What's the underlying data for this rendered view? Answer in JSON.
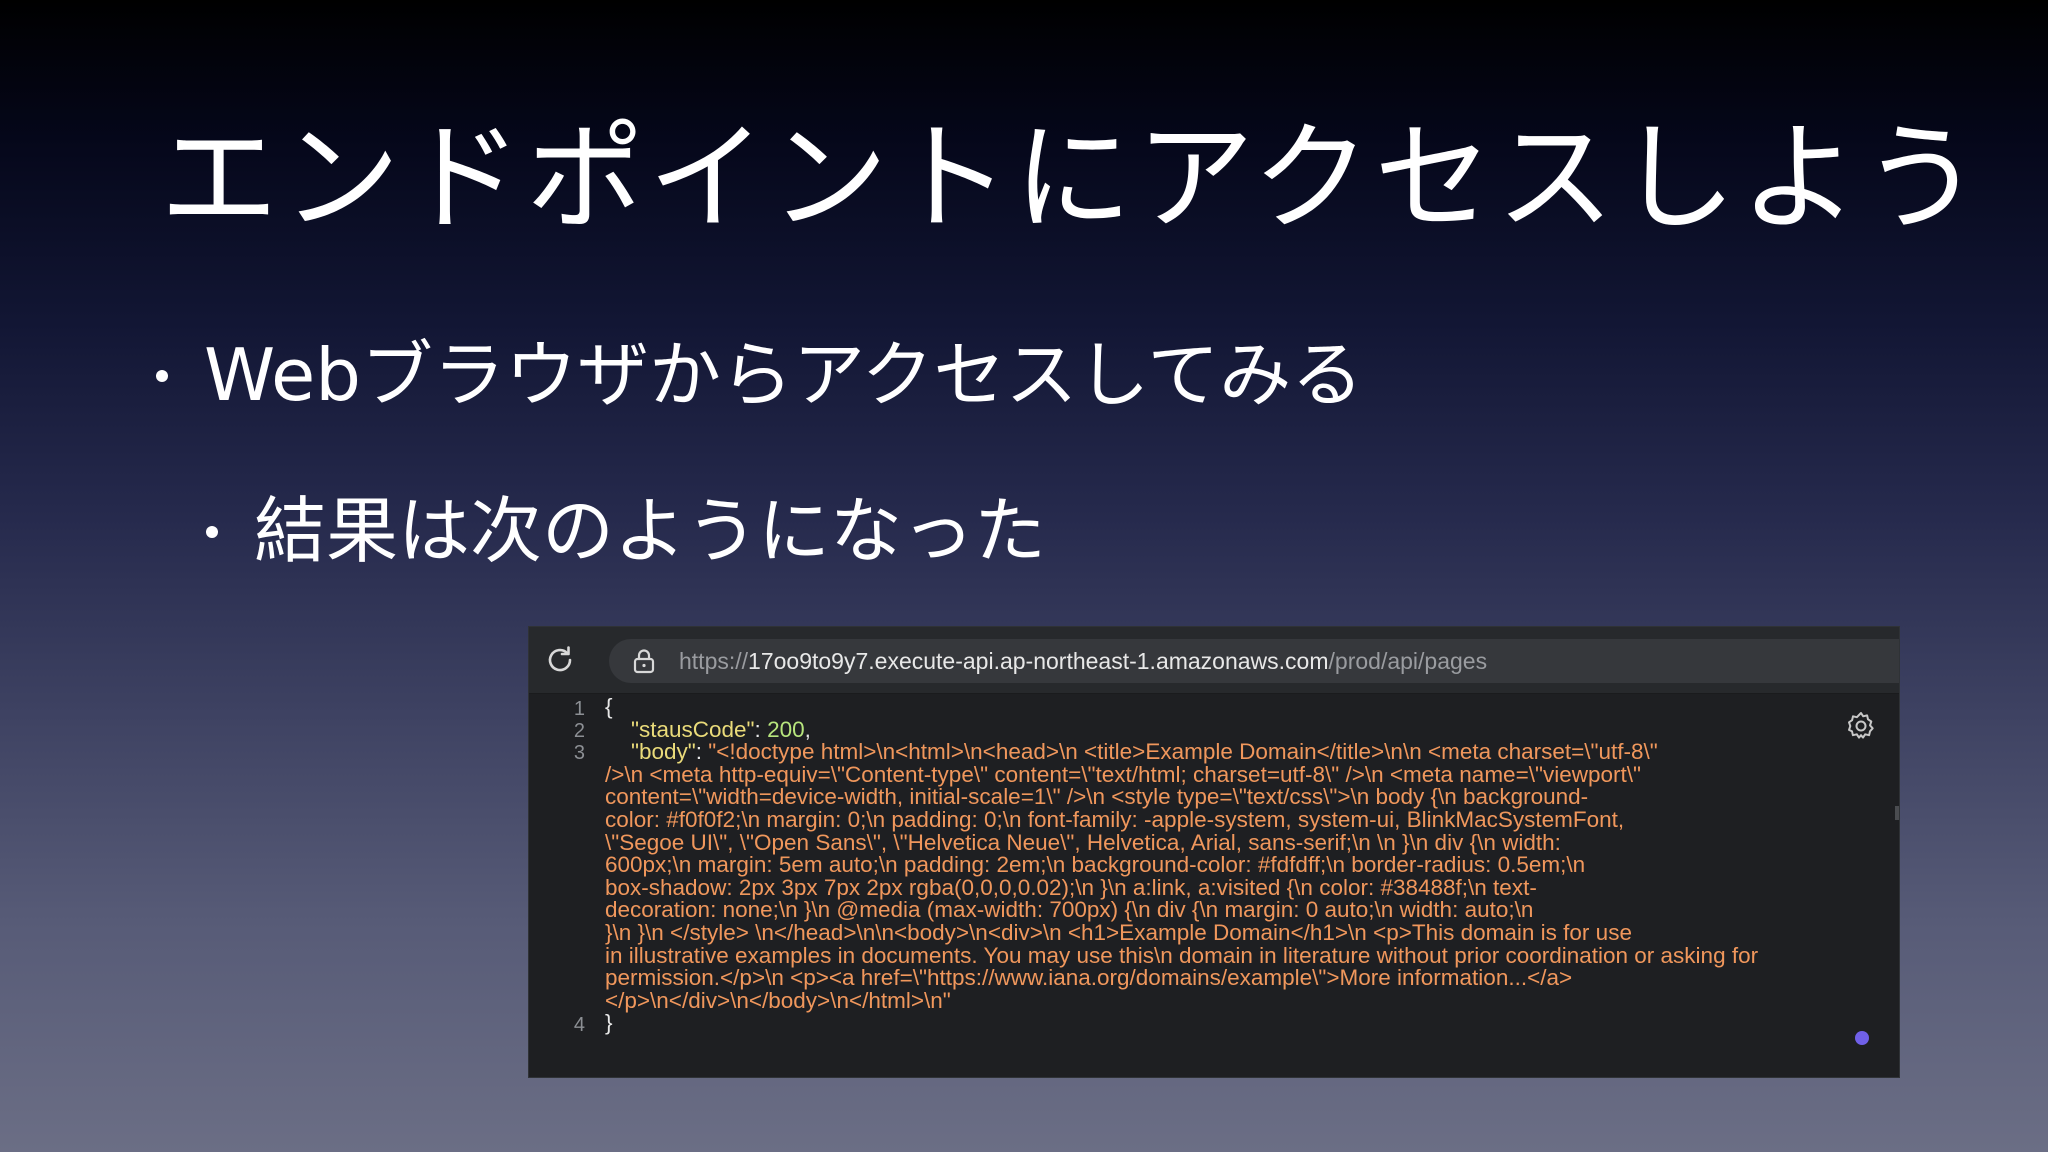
{
  "slide": {
    "title": "エンドポイントにアクセスしよう",
    "bullets": [
      "Webブラウザからアクセスしてみる",
      "結果は次のようになった"
    ]
  },
  "browser": {
    "url_scheme": "https://",
    "url_host": "17oo9to9y7.execute-api.ap-northeast-1.amazonaws.com",
    "url_path": "/prod/api/pages",
    "line_numbers": [
      "1",
      "2",
      "3",
      "4"
    ],
    "json_open": "{",
    "json_close": "}",
    "status_key": "\"stausCode\"",
    "status_value": "200",
    "body_key": "\"body\"",
    "body_value_lines": [
      "\"<!doctype html>\\n<html>\\n<head>\\n    <title>Example Domain</title>\\n\\n    <meta charset=\\\"utf-8\\\"",
      "/>\\n    <meta http-equiv=\\\"Content-type\\\" content=\\\"text/html; charset=utf-8\\\" />\\n    <meta name=\\\"viewport\\\"",
      "content=\\\"width=device-width, initial-scale=1\\\" />\\n    <style type=\\\"text/css\\\">\\n    body {\\n        background-",
      "color: #f0f0f2;\\n        margin: 0;\\n        padding: 0;\\n        font-family: -apple-system, system-ui, BlinkMacSystemFont,",
      "\\\"Segoe UI\\\", \\\"Open Sans\\\", \\\"Helvetica Neue\\\", Helvetica, Arial, sans-serif;\\n        \\n    }\\n    div {\\n        width:",
      "600px;\\n        margin: 5em auto;\\n        padding: 2em;\\n        background-color: #fdfdff;\\n        border-radius: 0.5em;\\n",
      "    box-shadow: 2px 3px 7px 2px rgba(0,0,0,0.02);\\n    }\\n    a:link, a:visited {\\n        color: #38488f;\\n        text-",
      "decoration: none;\\n    }\\n    @media (max-width: 700px) {\\n        div {\\n            margin: 0 auto;\\n            width: auto;\\n",
      "    }\\n    }\\n    </style>    \\n</head>\\n\\n<body>\\n<div>\\n    <h1>Example Domain</h1>\\n    <p>This domain is for use",
      "in illustrative examples in documents. You may use this\\n    domain in literature without prior coordination or asking for",
      "permission.</p>\\n    <p><a href=\\\"https://www.iana.org/domains/example\\\">More information...</a>",
      "</p>\\n</div>\\n</body>\\n</html>\\n\""
    ]
  },
  "colors": {
    "json_key": "#eadb7a",
    "json_number": "#b7e57d",
    "json_string": "#f0975c",
    "accent_dot": "#7060e8"
  }
}
